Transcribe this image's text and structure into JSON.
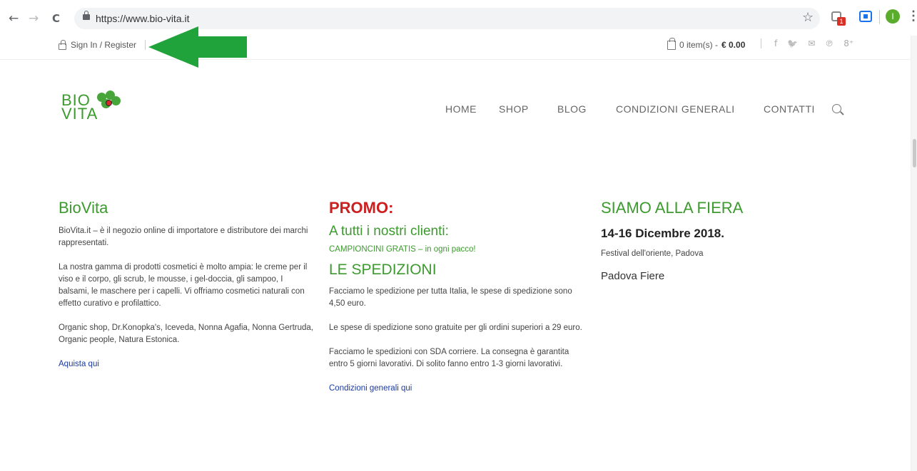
{
  "browser": {
    "url": "https://www.bio-vita.it",
    "back_icon": "←",
    "forward_icon": "→",
    "reload_icon": "C",
    "star_icon": "☆",
    "extension_badge": "1",
    "profile_initial": "I",
    "menu_icon": "⋮"
  },
  "topbar": {
    "signin_label": "Sign In / Register",
    "cart_count": "0 item(s) - ",
    "cart_total": "€ 0.00",
    "social_icons": [
      "f",
      "🐦",
      "✉",
      "℗",
      "8⁺"
    ]
  },
  "logo": {
    "line1": "BIO",
    "line2": "VITA"
  },
  "nav": {
    "items": [
      "HOME",
      "SHOP",
      "BLOG",
      "CONDIZIONI GENERALI",
      "CONTATTI"
    ]
  },
  "col1": {
    "heading": "BioVita",
    "p1": "BioVita.it  – è il negozio online di importatore e distributore dei marchi rappresentati.",
    "p2": "La nostra gamma di prodotti cosmetici è molto ampia: le creme per il viso e il corpo, gli scrub, le mousse, i gel-doccia, gli sampoo, I balsami, le maschere per i capelli. Vi offriamo cosmetici naturali con effetto curativo e profilattico.",
    "p3": "Organic shop, Dr.Konopka's, Iceveda, Nonna Agafia, Nonna Gertruda, Organic people, Natura Estonica.",
    "link": "Aquista qui"
  },
  "col2": {
    "promo": "PROMO:",
    "subheading": "A tutti i nostri clienti:",
    "gratis": "CAMPIONCINI GRATIS – in ogni pacco!",
    "spedizioni": "LE SPEDIZIONI",
    "p1": "Facciamo le spedizione per tutta Italia, le spese di spedizione sono 4,50 euro.",
    "p2": "Le spese di spedizione sono gratuite per gli ordini superiori a 29 euro.",
    "p3": "Facciamo le spedizioni con SDA corriere. La consegna è garantita entro 5 giorni lavorativi. Di solito fanno entro 1-3 giorni lavorativi.",
    "link": "Condizioni generali qui"
  },
  "col3": {
    "heading": "SIAMO ALLA FIERA",
    "date": "14-16 Dicembre 2018.",
    "event": "Festival dell'oriente, Padova",
    "venue": "Padova Fiere"
  },
  "colors": {
    "brand_green": "#3c9a2e",
    "promo_red": "#cc1f1f",
    "arrow_green": "#1fa33a",
    "link_blue": "#1a3aa0"
  }
}
